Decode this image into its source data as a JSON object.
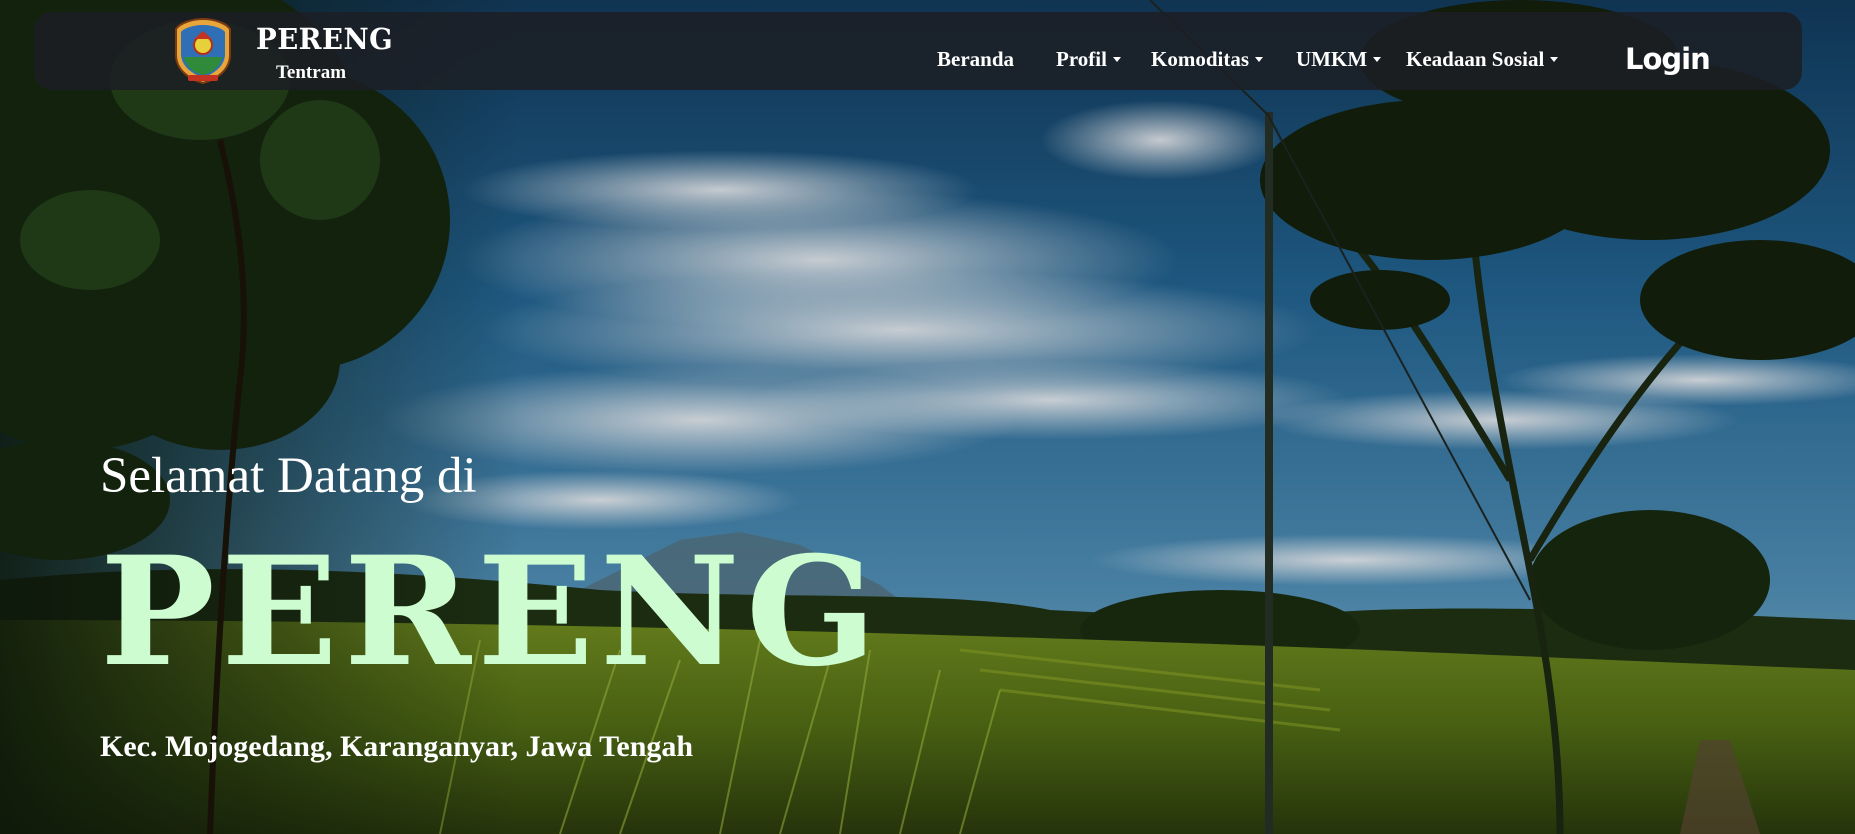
{
  "brand": {
    "title": "PERENG",
    "subtitle": "Tentram",
    "logo_icon": "regency-crest-icon"
  },
  "nav": {
    "items": [
      {
        "label": "Beranda",
        "dropdown": false
      },
      {
        "label": "Profil",
        "dropdown": true
      },
      {
        "label": "Komoditas",
        "dropdown": true
      },
      {
        "label": "UMKM",
        "dropdown": true
      },
      {
        "label": "Keadaan Sosial",
        "dropdown": true
      }
    ],
    "login_label": "Login"
  },
  "hero": {
    "welcome": "Selamat Datang di",
    "title": "PERENG",
    "location": "Kec. Mojogedang, Karanganyar, Jawa Tengah",
    "background": "rice-field-landscape-photo"
  },
  "colors": {
    "title_accent": "#ccfccf",
    "navbar_bg": "#1c1e24",
    "sky": "#2a6d9a"
  }
}
